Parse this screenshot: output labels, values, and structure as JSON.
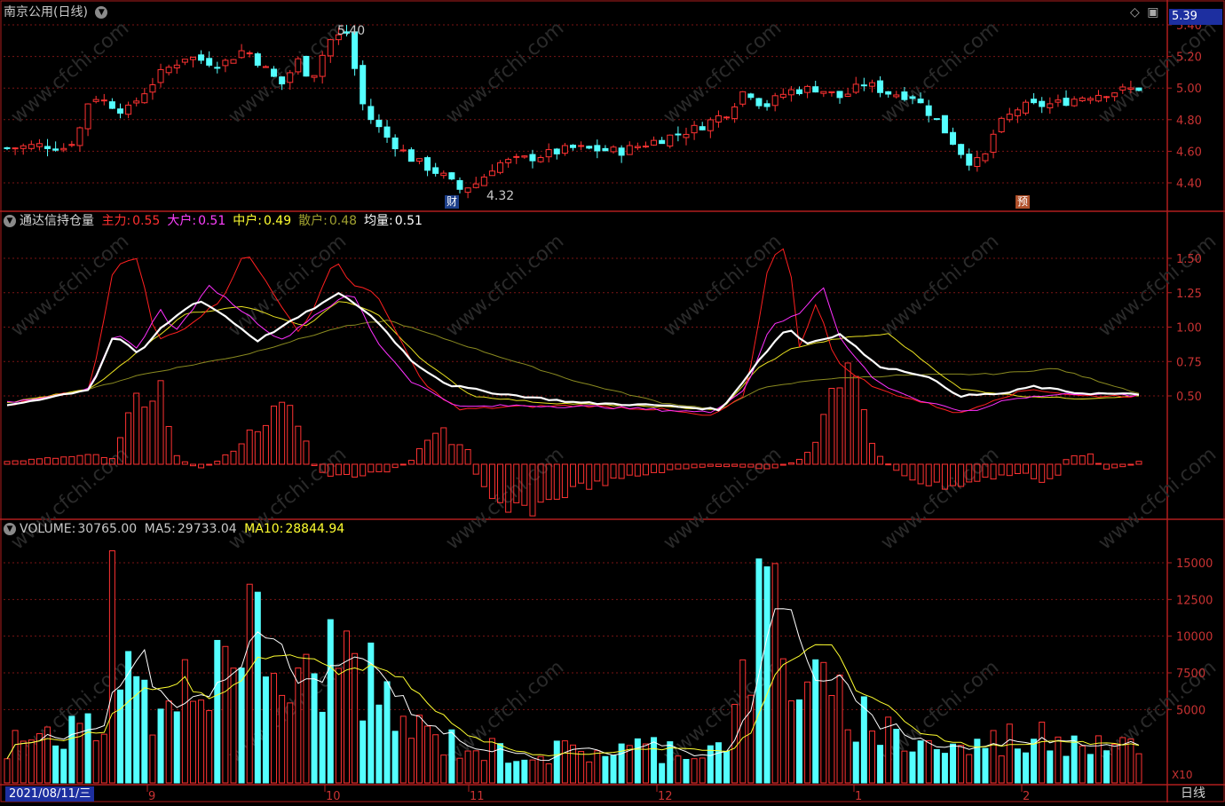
{
  "stock": {
    "title": "南京公用",
    "period_label": "(日线)",
    "current_price": "5.39",
    "high_label": "5.40",
    "low_label": "4.32",
    "event_fin": "财",
    "event_pre": "预"
  },
  "price_axis": [
    "5.40",
    "5.20",
    "5.00",
    "4.80",
    "4.60",
    "4.40"
  ],
  "indicator": {
    "name": "通达信持仓量",
    "items": [
      {
        "label": "主力:",
        "value": "0.55",
        "color": "#ff3030"
      },
      {
        "label": "大户:",
        "value": "0.51",
        "color": "#ff40ff"
      },
      {
        "label": "中户:",
        "value": "0.49",
        "color": "#ffff30"
      },
      {
        "label": "散户:",
        "value": "0.48",
        "color": "#a0a030"
      },
      {
        "label": "均量:",
        "value": "0.51",
        "color": "#ffffff"
      }
    ],
    "axis": [
      "1.50",
      "1.25",
      "1.00",
      "0.75",
      "0.50"
    ]
  },
  "volume": {
    "label": "VOLUME:",
    "value": "30765.00",
    "ma5_label": "MA5:",
    "ma5_value": "29733.04",
    "ma10_label": "MA10:",
    "ma10_value": "28844.94",
    "axis": [
      "15000",
      "12500",
      "10000",
      "7500",
      "5000"
    ],
    "unit": "X10"
  },
  "time_axis": {
    "current_date": "2021/08/11/三",
    "months": [
      "9",
      "10",
      "11",
      "12",
      "1",
      "2"
    ],
    "period": "日线"
  },
  "colors": {
    "up": "#ff3232",
    "down": "#54ffff",
    "grid": "#7a1515",
    "border": "#b01e1e"
  }
}
